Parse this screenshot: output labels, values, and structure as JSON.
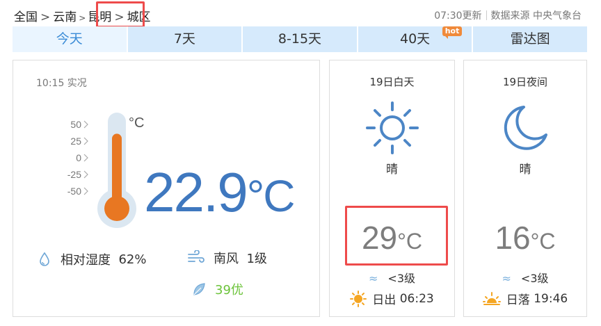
{
  "breadcrumb": {
    "items": [
      "全国",
      "云南",
      "昆明",
      "城区"
    ],
    "sep": ">"
  },
  "header": {
    "update_time": "07:30更新",
    "source": "数据来源 中央气象台"
  },
  "tabs": [
    {
      "label": "今天",
      "active": true
    },
    {
      "label": "7天"
    },
    {
      "label": "8-15天"
    },
    {
      "label": "40天",
      "badge": "hot"
    },
    {
      "label": "雷达图"
    }
  ],
  "current": {
    "obs_label": "10:15 实况",
    "temperature": "22.9",
    "unit": "°C",
    "thermometer": {
      "ticks": [
        "50",
        "25",
        "0",
        "-25",
        "-50"
      ],
      "unit": "°C",
      "level_value": 22.9,
      "range": [
        -50,
        50
      ]
    },
    "humidity_label": "相对湿度",
    "humidity_value": "62%",
    "wind_direction": "南风",
    "wind_level": "1级",
    "aqi": "39优"
  },
  "day": {
    "title": "19日白天",
    "weather": "晴",
    "temp": "29",
    "unit": "°C",
    "wind": "<3级",
    "sun_label": "日出",
    "sun_time": "06:23"
  },
  "night": {
    "title": "19日夜间",
    "weather": "晴",
    "temp": "16",
    "unit": "°C",
    "wind": "<3级",
    "sun_label": "日落",
    "sun_time": "19:46"
  },
  "colors": {
    "tab_bg": "#d6eafc",
    "tab_active_bg": "#eaf5ff",
    "tab_active_text": "#3a8bd6",
    "temp_blue": "#3f78bf",
    "highlight_red": "#ee4b4b",
    "aqi_green": "#6cc33a",
    "thermo_orange": "#e87722",
    "hot_badge": "#f08a3a"
  }
}
